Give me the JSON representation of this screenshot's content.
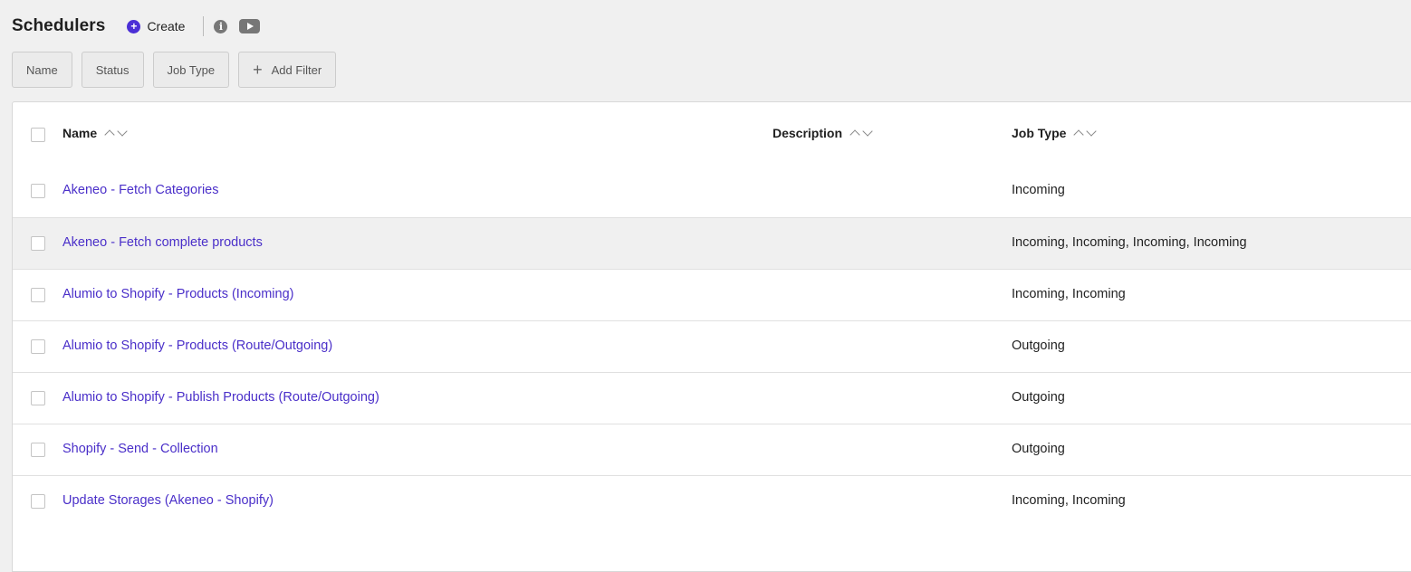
{
  "header": {
    "title": "Schedulers",
    "create_label": "Create",
    "info_glyph": "i"
  },
  "filters": [
    {
      "label": "Name"
    },
    {
      "label": "Status"
    },
    {
      "label": "Job Type"
    },
    {
      "label": "Add Filter"
    }
  ],
  "table": {
    "columns": [
      "Name",
      "Description",
      "Job Type"
    ],
    "rows": [
      {
        "name": "Akeneo - Fetch Categories",
        "description": "",
        "job_type": "Incoming"
      },
      {
        "name": "Akeneo - Fetch complete products",
        "description": "",
        "job_type": "Incoming, Incoming, Incoming, Incoming"
      },
      {
        "name": "Alumio to Shopify - Products (Incoming)",
        "description": "",
        "job_type": "Incoming, Incoming"
      },
      {
        "name": "Alumio to Shopify - Products (Route/Outgoing)",
        "description": "",
        "job_type": "Outgoing"
      },
      {
        "name": "Alumio to Shopify - Publish Products (Route/Outgoing)",
        "description": "",
        "job_type": "Outgoing"
      },
      {
        "name": "Shopify - Send - Collection",
        "description": "",
        "job_type": "Outgoing"
      },
      {
        "name": "Update Storages (Akeneo - Shopify)",
        "description": "",
        "job_type": "Incoming, Incoming"
      }
    ]
  },
  "colors": {
    "accent": "#4b2fd6",
    "link": "#4a2fc9",
    "hover_row": "#f0f0f0"
  },
  "icons": [
    "plus-circle-icon",
    "info-icon",
    "youtube-icon",
    "plus-icon",
    "sort-asc-icon",
    "sort-desc-icon"
  ]
}
